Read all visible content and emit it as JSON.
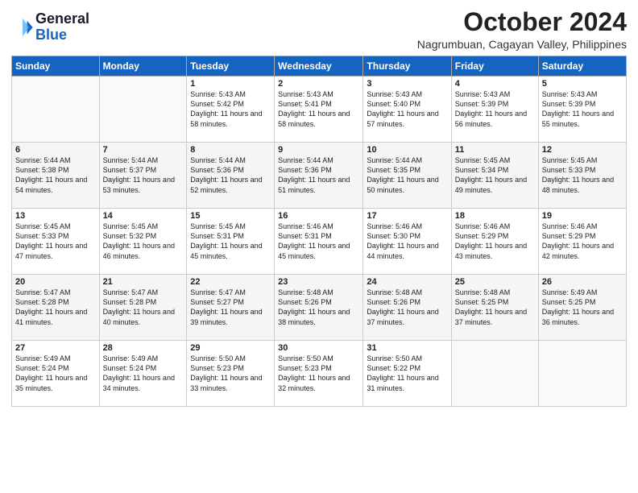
{
  "header": {
    "logo_line1": "General",
    "logo_line2": "Blue",
    "month_year": "October 2024",
    "location": "Nagrumbuan, Cagayan Valley, Philippines"
  },
  "days_of_week": [
    "Sunday",
    "Monday",
    "Tuesday",
    "Wednesday",
    "Thursday",
    "Friday",
    "Saturday"
  ],
  "weeks": [
    [
      {
        "day": "",
        "content": ""
      },
      {
        "day": "",
        "content": ""
      },
      {
        "day": "1",
        "content": "Sunrise: 5:43 AM\nSunset: 5:42 PM\nDaylight: 11 hours and 58 minutes."
      },
      {
        "day": "2",
        "content": "Sunrise: 5:43 AM\nSunset: 5:41 PM\nDaylight: 11 hours and 58 minutes."
      },
      {
        "day": "3",
        "content": "Sunrise: 5:43 AM\nSunset: 5:40 PM\nDaylight: 11 hours and 57 minutes."
      },
      {
        "day": "4",
        "content": "Sunrise: 5:43 AM\nSunset: 5:39 PM\nDaylight: 11 hours and 56 minutes."
      },
      {
        "day": "5",
        "content": "Sunrise: 5:43 AM\nSunset: 5:39 PM\nDaylight: 11 hours and 55 minutes."
      }
    ],
    [
      {
        "day": "6",
        "content": "Sunrise: 5:44 AM\nSunset: 5:38 PM\nDaylight: 11 hours and 54 minutes."
      },
      {
        "day": "7",
        "content": "Sunrise: 5:44 AM\nSunset: 5:37 PM\nDaylight: 11 hours and 53 minutes."
      },
      {
        "day": "8",
        "content": "Sunrise: 5:44 AM\nSunset: 5:36 PM\nDaylight: 11 hours and 52 minutes."
      },
      {
        "day": "9",
        "content": "Sunrise: 5:44 AM\nSunset: 5:36 PM\nDaylight: 11 hours and 51 minutes."
      },
      {
        "day": "10",
        "content": "Sunrise: 5:44 AM\nSunset: 5:35 PM\nDaylight: 11 hours and 50 minutes."
      },
      {
        "day": "11",
        "content": "Sunrise: 5:45 AM\nSunset: 5:34 PM\nDaylight: 11 hours and 49 minutes."
      },
      {
        "day": "12",
        "content": "Sunrise: 5:45 AM\nSunset: 5:33 PM\nDaylight: 11 hours and 48 minutes."
      }
    ],
    [
      {
        "day": "13",
        "content": "Sunrise: 5:45 AM\nSunset: 5:33 PM\nDaylight: 11 hours and 47 minutes."
      },
      {
        "day": "14",
        "content": "Sunrise: 5:45 AM\nSunset: 5:32 PM\nDaylight: 11 hours and 46 minutes."
      },
      {
        "day": "15",
        "content": "Sunrise: 5:45 AM\nSunset: 5:31 PM\nDaylight: 11 hours and 45 minutes."
      },
      {
        "day": "16",
        "content": "Sunrise: 5:46 AM\nSunset: 5:31 PM\nDaylight: 11 hours and 45 minutes."
      },
      {
        "day": "17",
        "content": "Sunrise: 5:46 AM\nSunset: 5:30 PM\nDaylight: 11 hours and 44 minutes."
      },
      {
        "day": "18",
        "content": "Sunrise: 5:46 AM\nSunset: 5:29 PM\nDaylight: 11 hours and 43 minutes."
      },
      {
        "day": "19",
        "content": "Sunrise: 5:46 AM\nSunset: 5:29 PM\nDaylight: 11 hours and 42 minutes."
      }
    ],
    [
      {
        "day": "20",
        "content": "Sunrise: 5:47 AM\nSunset: 5:28 PM\nDaylight: 11 hours and 41 minutes."
      },
      {
        "day": "21",
        "content": "Sunrise: 5:47 AM\nSunset: 5:28 PM\nDaylight: 11 hours and 40 minutes."
      },
      {
        "day": "22",
        "content": "Sunrise: 5:47 AM\nSunset: 5:27 PM\nDaylight: 11 hours and 39 minutes."
      },
      {
        "day": "23",
        "content": "Sunrise: 5:48 AM\nSunset: 5:26 PM\nDaylight: 11 hours and 38 minutes."
      },
      {
        "day": "24",
        "content": "Sunrise: 5:48 AM\nSunset: 5:26 PM\nDaylight: 11 hours and 37 minutes."
      },
      {
        "day": "25",
        "content": "Sunrise: 5:48 AM\nSunset: 5:25 PM\nDaylight: 11 hours and 37 minutes."
      },
      {
        "day": "26",
        "content": "Sunrise: 5:49 AM\nSunset: 5:25 PM\nDaylight: 11 hours and 36 minutes."
      }
    ],
    [
      {
        "day": "27",
        "content": "Sunrise: 5:49 AM\nSunset: 5:24 PM\nDaylight: 11 hours and 35 minutes."
      },
      {
        "day": "28",
        "content": "Sunrise: 5:49 AM\nSunset: 5:24 PM\nDaylight: 11 hours and 34 minutes."
      },
      {
        "day": "29",
        "content": "Sunrise: 5:50 AM\nSunset: 5:23 PM\nDaylight: 11 hours and 33 minutes."
      },
      {
        "day": "30",
        "content": "Sunrise: 5:50 AM\nSunset: 5:23 PM\nDaylight: 11 hours and 32 minutes."
      },
      {
        "day": "31",
        "content": "Sunrise: 5:50 AM\nSunset: 5:22 PM\nDaylight: 11 hours and 31 minutes."
      },
      {
        "day": "",
        "content": ""
      },
      {
        "day": "",
        "content": ""
      }
    ]
  ]
}
